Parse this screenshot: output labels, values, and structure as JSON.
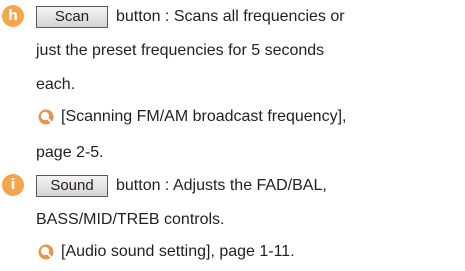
{
  "items": [
    {
      "marker": "h",
      "button_label": "Scan",
      "line1": "button : Scans all frequencies or",
      "line2": "just the preset frequencies for 5 seconds",
      "line3": "each.",
      "ref_text": "[Scanning FM/AM broadcast frequency],",
      "ref_text_cont": "page 2-5."
    },
    {
      "marker": "i",
      "button_label": "Sound",
      "line1": "button : Adjusts the FAD/BAL,",
      "line2": "BASS/MID/TREB controls.",
      "ref_text": "[Audio sound setting], page 1-11."
    }
  ],
  "colors": {
    "marker": "#f5a54a",
    "text": "#231f20",
    "ref_icon": "#e8954c"
  },
  "icons": {
    "reference": "magnifier-reference-icon"
  }
}
